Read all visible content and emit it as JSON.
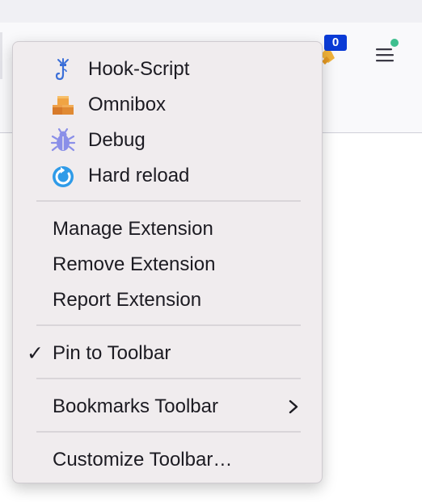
{
  "toolbar": {
    "extension_badge": "0"
  },
  "menu": {
    "extension_actions": [
      {
        "label": "Hook-Script",
        "icon": "hook-icon"
      },
      {
        "label": "Omnibox",
        "icon": "boxes-icon"
      },
      {
        "label": "Debug",
        "icon": "bug-icon"
      },
      {
        "label": "Hard reload",
        "icon": "reload-icon"
      }
    ],
    "manage_label": "Manage Extension",
    "remove_label": "Remove Extension",
    "report_label": "Report Extension",
    "pin_label": "Pin to Toolbar",
    "pin_checked": true,
    "bookmarks_label": "Bookmarks Toolbar",
    "customize_label": "Customize Toolbar…"
  },
  "colors": {
    "menu_background": "#f0ecee",
    "badge_background": "#0a3bd6",
    "notification_dot": "#3fbf8f"
  }
}
